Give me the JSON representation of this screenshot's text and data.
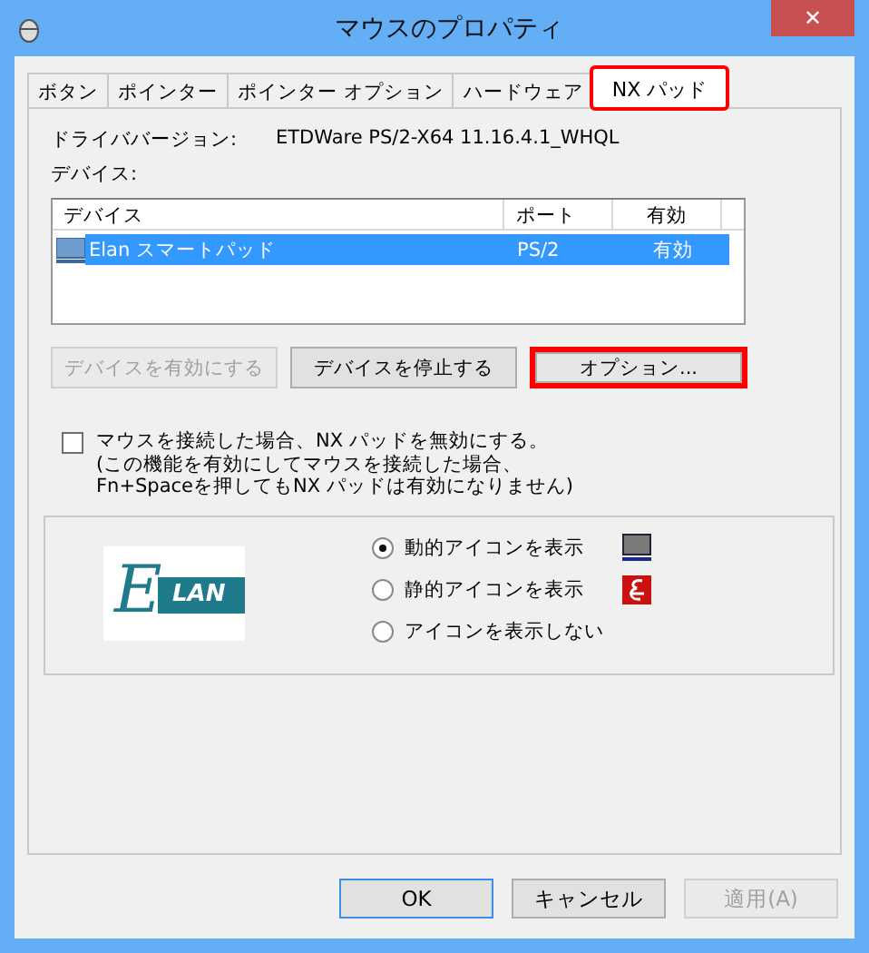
{
  "window": {
    "title": "マウスのプロパティ",
    "close": "✕"
  },
  "tabs": [
    {
      "label": "ボタン",
      "selected": false,
      "highlighted": false
    },
    {
      "label": "ポインター",
      "selected": false,
      "highlighted": false
    },
    {
      "label": "ポインター オプション",
      "selected": false,
      "highlighted": false
    },
    {
      "label": "ハードウェア",
      "selected": false,
      "highlighted": false
    },
    {
      "label": "NX パッド",
      "selected": true,
      "highlighted": true
    }
  ],
  "driver": {
    "label": "ドライババージョン:",
    "value": "ETDWare PS/2-X64 11.16.4.1_WHQL"
  },
  "devices_label": "デバイス:",
  "table": {
    "columns": [
      "デバイス",
      "ポート",
      "有効"
    ],
    "rows": [
      {
        "cells": [
          "Elan スマートパッド",
          "PS/2",
          "有効"
        ],
        "selected": true
      }
    ]
  },
  "device_buttons": [
    {
      "label": "デバイスを有効にする",
      "disabled": true,
      "highlighted": false
    },
    {
      "label": "デバイスを停止する",
      "disabled": false,
      "highlighted": false
    },
    {
      "label": "オプション...",
      "disabled": false,
      "highlighted": true
    }
  ],
  "disable_option": {
    "checked": false,
    "lines": [
      "マウスを接続した場合、NX パッドを無効にする。",
      "(この機能を有効にしてマウスを接続した場合、",
      "Fn+Spaceを押してもNX パッドは有効になりません)"
    ]
  },
  "logo": {
    "letter": "E",
    "text": "LAN"
  },
  "icon_options": [
    {
      "label": "動的アイコンを表示",
      "selected": true,
      "kind": "screen"
    },
    {
      "label": "静的アイコンを表示",
      "selected": false,
      "kind": "logo"
    },
    {
      "label": "アイコンを表示しない",
      "selected": false,
      "kind": "none"
    }
  ],
  "buttons": [
    {
      "label": "OK",
      "disabled": false,
      "default": true
    },
    {
      "label": "キャンセル",
      "disabled": false,
      "default": false
    },
    {
      "label": "適用(A)",
      "disabled": true,
      "default": false
    }
  ]
}
